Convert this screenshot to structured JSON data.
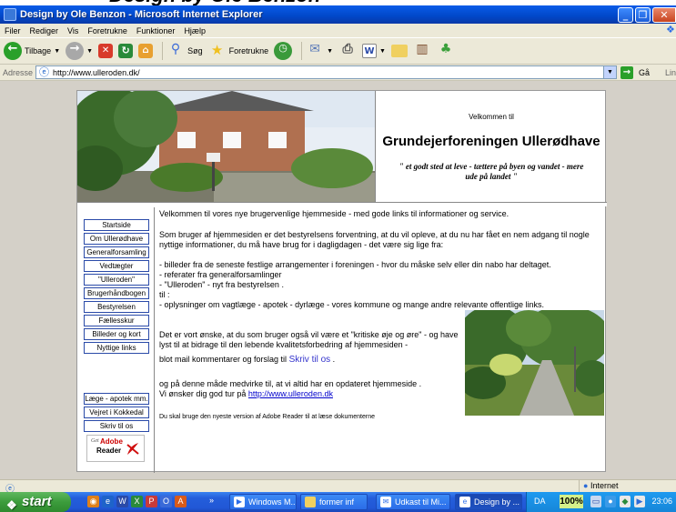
{
  "window": {
    "title": "Design by Ole Benzon - Microsoft Internet Explorer"
  },
  "menu": [
    "Filer",
    "Rediger",
    "Vis",
    "Foretrukne",
    "Funktioner",
    "Hjælp"
  ],
  "toolbar": {
    "back": "Tilbage",
    "search": "Søg",
    "favorites": "Foretrukne"
  },
  "address": {
    "label": "Adresse",
    "url": "http://www.ulleroden.dk/",
    "go": "Gå",
    "links": "Lin"
  },
  "page": {
    "welcome_small": "Velkommen til",
    "welcome_title": "Grundejerforeningen Ullerødhave",
    "motto": "\" et godt sted at leve - tættere på byen og vandet - mere ude på landet \"",
    "nav_main": [
      "Startside",
      "Om Ullerødhave",
      "Generalforsamling",
      "Vedtægter",
      "\"Ulleroden\"",
      "Brugerhåndbogen",
      "Bestyrelsen",
      "Fællesskur",
      "Billeder og kort",
      "Nyttige links"
    ],
    "nav_extra": [
      "Læge - apotek mm.",
      "Vejret i Kokkedal",
      "Skriv til os"
    ],
    "adobe": {
      "get": "Get",
      "brand": "Adobe",
      "reader": "Reader"
    },
    "intro": "Velkommen til vores nye brugervenlige hjemmeside - med gode links til informationer og service.",
    "para2": "Som bruger af hjemmesiden er det bestyrelsens forventning, at du vil opleve, at du nu har fået en nem adgang til nogle nyttige informationer, du må have brug for i dagligdagen - det være sig lige fra:",
    "bullets": [
      "- billeder fra de seneste festlige arrangementer i foreningen - hvor du måske selv eller din nabo har deltaget.",
      "- referater fra generalforsamlinger",
      "- \"Ulleroden\" - nyt fra bestyrelsen .",
      "til :",
      "- oplysninger om vagtlæge - apotek - dyrlæge - vores kommune og mange andre relevante offentlige links."
    ],
    "wish1": "Det er vort ønske, at du som bruger også vil være et \"kritiske øje og øre\" - og have lyst til at bidrage til den lebende kvalitetsforbedring af hjemmesiden -",
    "wish2": "blot mail kommentarer og forslag til",
    "skriv_link": "Skriv til os",
    "wish2_end": ".",
    "wish3": "og på denne måde medvirke til, at vi altid har en opdateret hjemmeside .",
    "wish4": "Vi ønsker dig god tur på",
    "site_link": "http://www.ulleroden.dk",
    "adobe_note": "Du skal bruge den nyeste version af Adobe Reader til at læse dokumenterne"
  },
  "status": {
    "zone": "Internet"
  },
  "taskbar": {
    "start": "start",
    "tasks": [
      "Windows M...",
      "former inf",
      "Udkast til Mi...",
      "Design by ..."
    ],
    "lang": "DA",
    "zoom": "100%",
    "clock": "23:06"
  }
}
